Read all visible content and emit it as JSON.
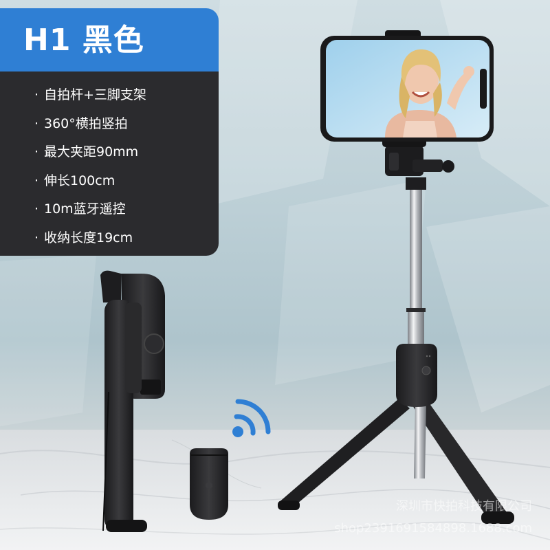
{
  "product": {
    "title": "H1 黑色",
    "features": [
      "自拍杆+三脚支架",
      "360°横拍竖拍",
      "最大夹距90mm",
      "伸长100cm",
      "10m蓝牙遥控",
      "收纳长度19cm"
    ],
    "bullet": "·"
  },
  "watermark": {
    "line1": "深圳市快拍科技有限公司",
    "line2": "shop2391691584898.1688.com"
  },
  "colors": {
    "title_bg": "#2f7fd4",
    "panel_bg": "#2b2b2e",
    "wireless_icon": "#2f7fd4"
  }
}
